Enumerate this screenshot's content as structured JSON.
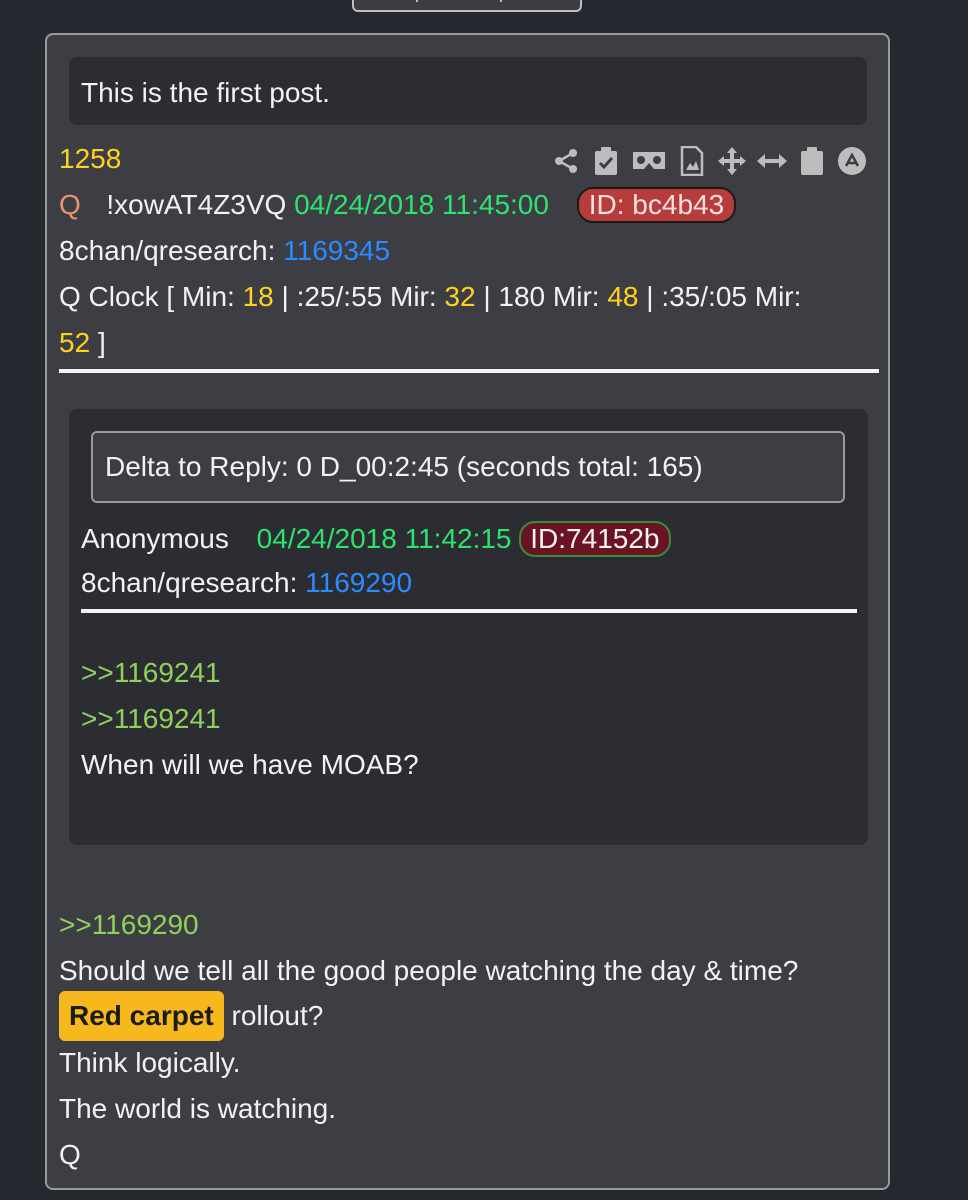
{
  "first_post_text": "This is the first post.",
  "post_number": "1258",
  "author": {
    "name": "Q",
    "tripcode": "!xowAT4Z3VQ",
    "timestamp": "04/24/2018 11:45:00",
    "id": "ID: bc4b43"
  },
  "source": {
    "label": "8chan/qresearch:",
    "number": "1169345"
  },
  "clock": {
    "prefix": "Q Clock [ Min:",
    "min": "18",
    "mid1": "| :25/:55 Mir:",
    "mir1": "32",
    "mid2": "| 180 Mir:",
    "mir2": "48",
    "mid3": "| :35/:05 Mir:",
    "mir3": "52",
    "suffix": "]"
  },
  "icons": [
    "share-icon",
    "clipboard-check-icon",
    "vr-goggles-icon",
    "image-file-icon",
    "move-icon",
    "resize-horizontal-icon",
    "clipboard-icon",
    "scroll-top-icon"
  ],
  "reply": {
    "delta": "Delta to Reply: 0 D_00:2:45  (seconds total: 165)",
    "author": "Anonymous",
    "timestamp": "04/24/2018 11:42:15",
    "id": "ID:74152b",
    "source_label": "8chan/qresearch:",
    "source_number": "1169290",
    "quote1": ">>1169241",
    "quote2": ">>1169241",
    "body": "When will we have MOAB?"
  },
  "body": {
    "quote": ">>1169290",
    "line1": "Should we tell all the good people watching the day & time?",
    "highlight": "Red carpet",
    "line2_rest": "rollout?",
    "line3": "Think logically.",
    "line4": "The world is watching.",
    "signature": "Q"
  },
  "colors": {
    "post_number": "#ffd21f",
    "timestamp": "#2ee26e",
    "link": "#2a8cff",
    "greentext": "#8fd25a",
    "id_badge": "#b73c3c",
    "highlight": "#f6b81c"
  }
}
